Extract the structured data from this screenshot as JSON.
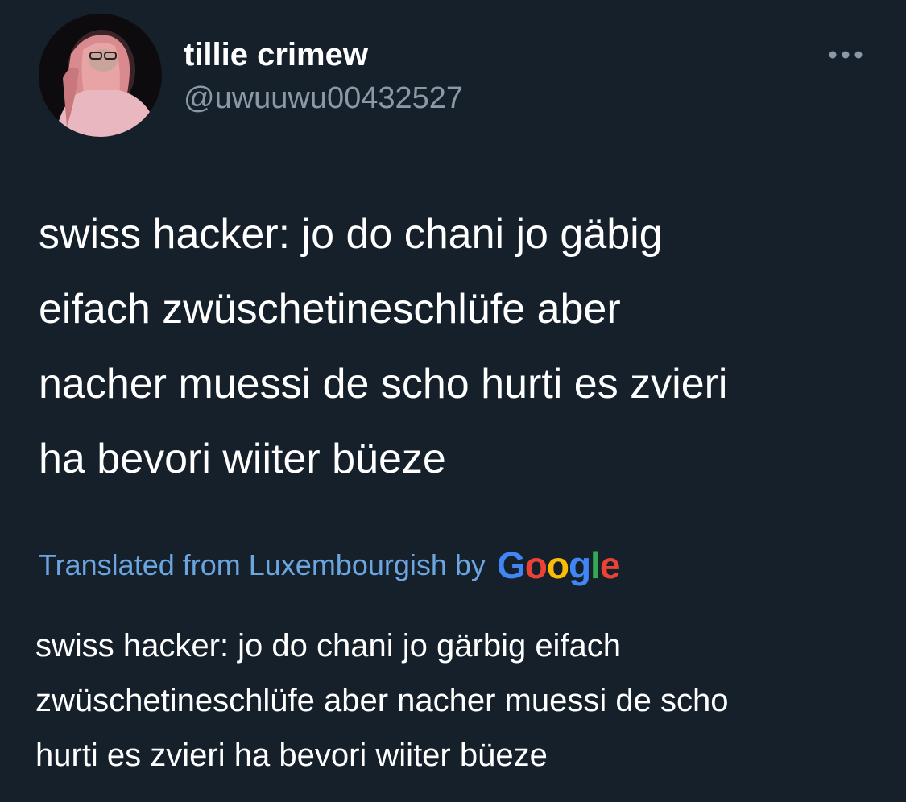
{
  "author": {
    "display_name": "tillie crimew",
    "handle": "@uwuuwu00432527",
    "avatar_icon": "profile-photo"
  },
  "more_icon": "more-horizontal-icon",
  "tweet": {
    "lines": [
      "swiss hacker: jo do chani jo gäbig",
      "eifach zwüschetineschlüfe aber",
      "nacher muessi de scho hurti es zvieri",
      "ha bevori wiiter büeze"
    ]
  },
  "translation": {
    "label": "Translated from Luxembourgish by",
    "provider_letters": [
      "G",
      "o",
      "o",
      "g",
      "l",
      "e"
    ],
    "provider_colors": [
      "#4285f4",
      "#ea4335",
      "#fbbc05",
      "#4285f4",
      "#34a853",
      "#ea4335"
    ],
    "lines": [
      "swiss hacker: jo do chani jo gärbig eifach",
      "zwüschetineschlüfe aber nacher muessi de scho",
      "hurti es zvieri ha bevori wiiter büeze"
    ]
  },
  "colors": {
    "background": "#15202b",
    "text": "#ffffff",
    "secondary_text": "#8b98a5",
    "link": "#6ba6e0"
  }
}
